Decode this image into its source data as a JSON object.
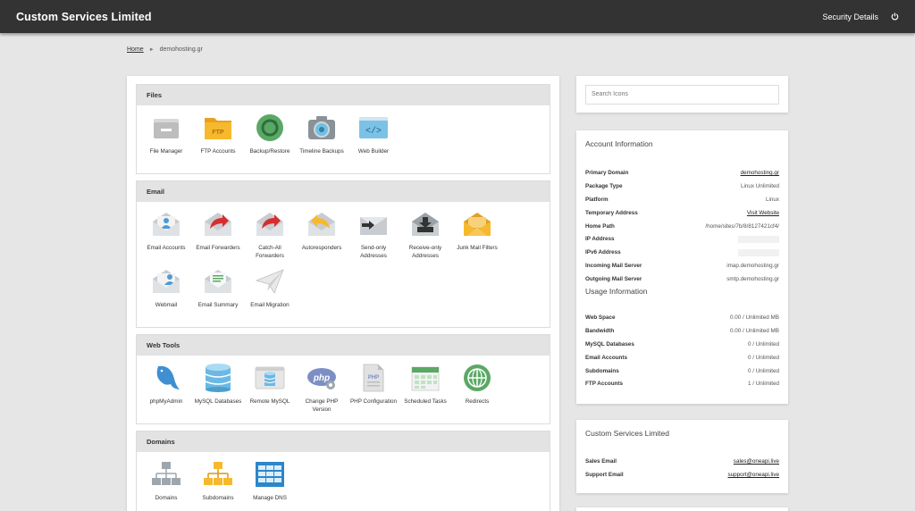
{
  "header": {
    "brand": "Custom Services Limited",
    "security_link": "Security Details"
  },
  "breadcrumb": {
    "home": "Home",
    "current": "demohosting.gr"
  },
  "search": {
    "placeholder": "Search Icons"
  },
  "sections": {
    "files": {
      "title": "Files",
      "items": [
        "File Manager",
        "FTP Accounts",
        "Backup/Restore",
        "Timeline Backups",
        "Web Builder"
      ]
    },
    "email": {
      "title": "Email",
      "items": [
        "Email Accounts",
        "Email Forwarders",
        "Catch-All Forwarders",
        "Autoresponders",
        "Send-only Addresses",
        "Receive-only Addresses",
        "Junk Mail Filters",
        "Webmail",
        "Email Summary",
        "Email Migration"
      ]
    },
    "webtools": {
      "title": "Web Tools",
      "items": [
        "phpMyAdmin",
        "MySQL Databases",
        "Remote MySQL",
        "Change PHP Version",
        "PHP Configuration",
        "Scheduled Tasks",
        "Redirects"
      ]
    },
    "domains": {
      "title": "Domains",
      "items": [
        "Domains",
        "Subdomains",
        "Manage DNS"
      ]
    }
  },
  "account": {
    "title": "Account Information",
    "rows": [
      {
        "key": "Primary Domain",
        "value": "demohosting.gr"
      },
      {
        "key": "Package Type",
        "value": "Linux Unlimited"
      },
      {
        "key": "Platform",
        "value": "Linux"
      },
      {
        "key": "Temporary Address",
        "value": "Visit Website"
      },
      {
        "key": "Home Path",
        "value": "/home/sites/7b/8/8127421cf4/"
      },
      {
        "key": "IP Address",
        "value": ""
      },
      {
        "key": "IPv6 Address",
        "value": ""
      },
      {
        "key": "Incoming Mail Server",
        "value": "imap.demohosting.gr"
      },
      {
        "key": "Outgoing Mail Server",
        "value": "smtp.demohosting.gr"
      }
    ]
  },
  "usage": {
    "title": "Usage Information",
    "rows": [
      {
        "key": "Web Space",
        "value": "0.00 / Unlimited MB"
      },
      {
        "key": "Bandwidth",
        "value": "0.00 / Unlimited MB"
      },
      {
        "key": "MySQL Databases",
        "value": "0 / Unlimited"
      },
      {
        "key": "Email Accounts",
        "value": "0 / Unlimited"
      },
      {
        "key": "Subdomains",
        "value": "0 / Unlimited"
      },
      {
        "key": "FTP Accounts",
        "value": "1 / Unlimited"
      }
    ]
  },
  "contact": {
    "title": "Custom Services Limited",
    "rows": [
      {
        "key": "Sales Email",
        "value": "sales@oneapi.live"
      },
      {
        "key": "Support Email",
        "value": "support@oneapi.live"
      }
    ]
  },
  "colors": {
    "topbar": "#333333",
    "background": "#e6e6e6",
    "section_header": "#e3e3e3",
    "red_accent": "#d62e2e",
    "folder_yellow": "#f6b92e",
    "green": "#5aa865",
    "blue": "#3f8fd1"
  }
}
